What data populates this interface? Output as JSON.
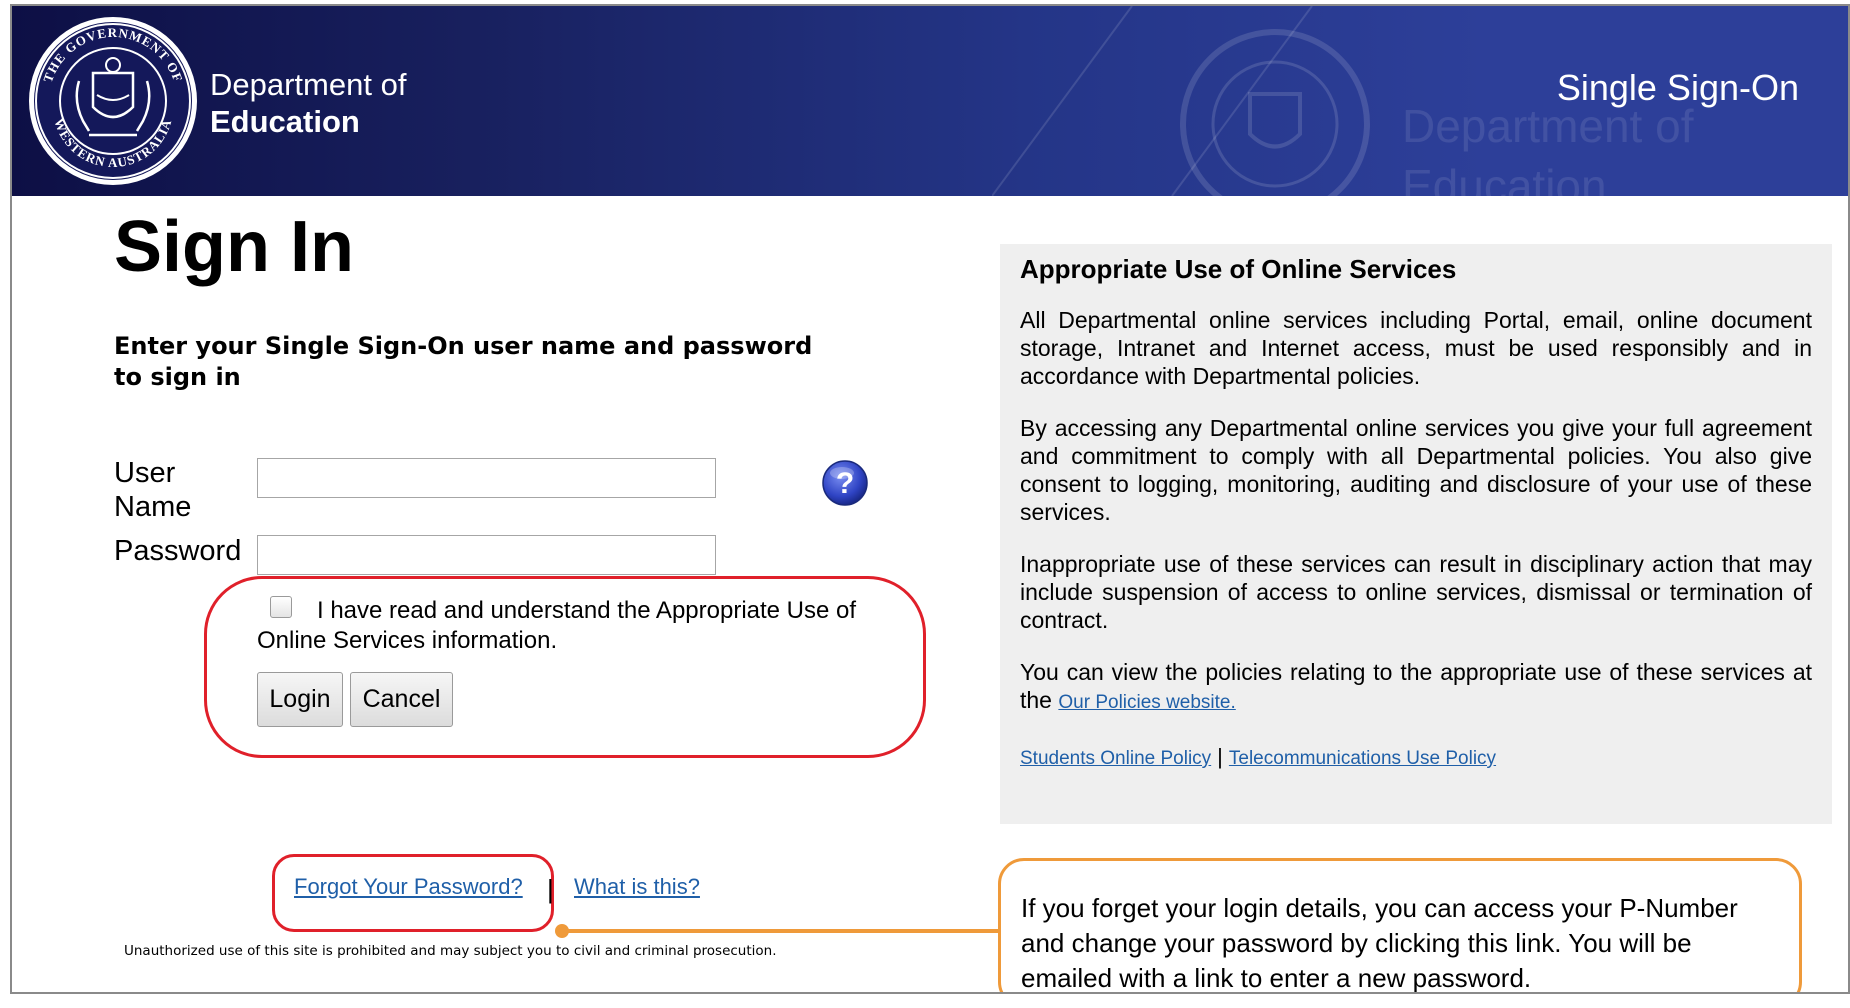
{
  "header": {
    "dept_line1": "Department of",
    "dept_line2": "Education",
    "sso_title": "Single Sign-On",
    "watermark_line1": "Department of",
    "watermark_line2": "Education"
  },
  "login": {
    "title": "Sign In",
    "instruction": "Enter your Single Sign-On user name and password to sign in",
    "username_label": "User Name",
    "password_label": "Password",
    "username_value": "",
    "password_value": "",
    "help_icon": "question-mark-icon",
    "agree_text": "I have read and understand the Appropriate Use of Online Services information.",
    "login_button": "Login",
    "cancel_button": "Cancel",
    "forgot_link": "Forgot Your Password?",
    "separator": "|",
    "what_is_link": "What is this?",
    "disclaimer": "Unauthorized use of this site is prohibited and may subject you to civil and criminal prosecution."
  },
  "policy": {
    "heading": "Appropriate Use of Online Services",
    "para1": "All Departmental online services including Portal, email, online document storage, Intranet and Internet access, must be used responsibly and in accordance with Departmental policies.",
    "para2": "By accessing any Departmental online services you give your full agreement and commitment to comply with all Departmental policies. You also give consent to logging, monitoring, auditing and disclosure of your use of these services.",
    "para3": "Inappropriate use of these services can result in disciplinary action that may include suspension of access to online services, dismissal or termination of contract.",
    "para4_prefix": "You can view the policies relating to the appropriate use of these services at the",
    "policies_link": "Our Policies website.",
    "students_link": "Students Online Policy",
    "separator": "|",
    "telecom_link": "Telecommunications Use Policy"
  },
  "callout": {
    "text": "If you forget your login details, you can access your P-Number and change your password by clicking this link. You will be emailed with a link to enter a new password."
  },
  "colors": {
    "header_dark": "#0d0f45",
    "header_light": "#2d3f99",
    "link": "#1f5fa8",
    "annotation_red": "#e0202a",
    "annotation_orange": "#ef9a3a",
    "panel_bg": "#efefef"
  }
}
